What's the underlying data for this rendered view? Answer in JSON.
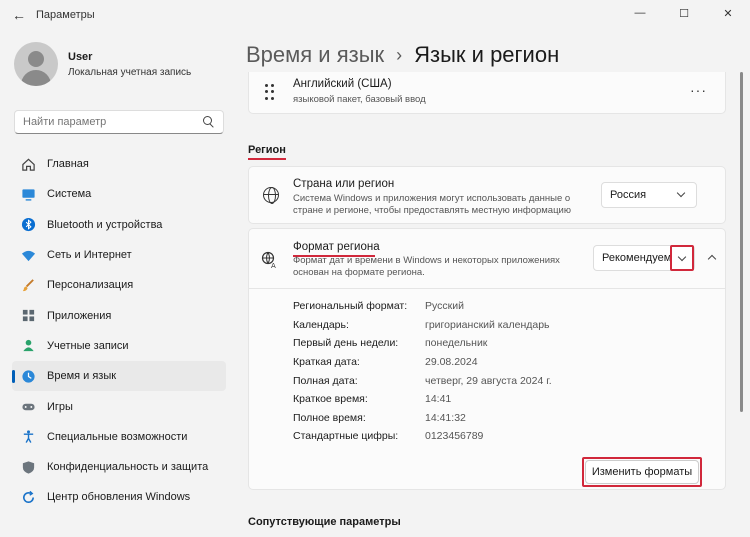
{
  "app": {
    "title": "Параметры"
  },
  "profile": {
    "name": "User",
    "account": "Локальная учетная запись"
  },
  "search": {
    "placeholder": "Найти параметр"
  },
  "nav": {
    "items": [
      {
        "label": "Главная",
        "icon": "home-icon"
      },
      {
        "label": "Система",
        "icon": "system-icon"
      },
      {
        "label": "Bluetooth и устройства",
        "icon": "bluetooth-icon"
      },
      {
        "label": "Сеть и Интернет",
        "icon": "wifi-icon"
      },
      {
        "label": "Персонализация",
        "icon": "brush-icon"
      },
      {
        "label": "Приложения",
        "icon": "apps-icon"
      },
      {
        "label": "Учетные записи",
        "icon": "accounts-icon"
      },
      {
        "label": "Время и язык",
        "icon": "time-language-icon"
      },
      {
        "label": "Игры",
        "icon": "gaming-icon"
      },
      {
        "label": "Специальные возможности",
        "icon": "accessibility-icon"
      },
      {
        "label": "Конфиденциальность и защита",
        "icon": "shield-icon"
      },
      {
        "label": "Центр обновления Windows",
        "icon": "update-icon"
      }
    ],
    "active_index": 7
  },
  "breadcrumb": {
    "parent": "Время и язык",
    "current": "Язык и регион"
  },
  "language": {
    "name": "Английский (США)",
    "detail": "языковой пакет, базовый ввод"
  },
  "region": {
    "section_title": "Регион",
    "country": {
      "title": "Страна или регион",
      "description": "Система Windows и приложения могут использовать данные о стране и регионе, чтобы предоставлять местную информацию",
      "value": "Россия"
    },
    "format": {
      "title": "Формат региона",
      "description": "Формат дат и времени в Windows и некоторых приложениях основан на формате региона.",
      "value": "Рекомендуем",
      "rows": [
        {
          "key": "Региональный формат:",
          "value": "Русский"
        },
        {
          "key": "Календарь:",
          "value": "григорианский календарь"
        },
        {
          "key": "Первый день недели:",
          "value": "понедельник"
        },
        {
          "key": "Краткая дата:",
          "value": "29.08.2024"
        },
        {
          "key": "Полная дата:",
          "value": "четверг, 29 августа 2024 г."
        },
        {
          "key": "Краткое время:",
          "value": "14:41"
        },
        {
          "key": "Полное время:",
          "value": "14:41:32"
        },
        {
          "key": "Стандартные цифры:",
          "value": "0123456789"
        }
      ],
      "change_button": "Изменить форматы"
    }
  },
  "related": {
    "title": "Сопутствующие параметры"
  },
  "colors": {
    "accent": "#005fb8",
    "highlight": "#d1283b"
  }
}
